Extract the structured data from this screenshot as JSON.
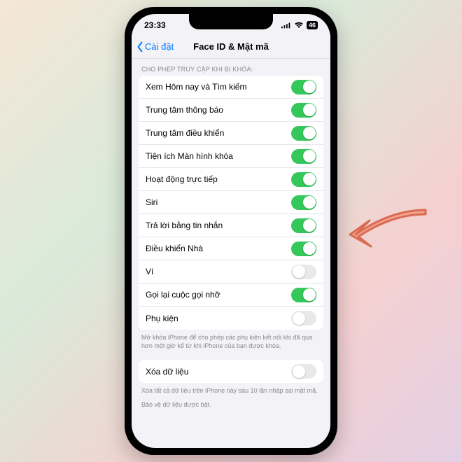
{
  "status": {
    "time": "23:33",
    "battery_text": "46"
  },
  "nav": {
    "back_label": "Cài đặt",
    "title": "Face ID & Mật mã"
  },
  "section1": {
    "header": "CHO PHÉP TRUY CẬP KHI BỊ KHÓA:",
    "rows": [
      {
        "label": "Xem Hôm nay và Tìm kiếm",
        "on": true
      },
      {
        "label": "Trung tâm thông báo",
        "on": true
      },
      {
        "label": "Trung tâm điều khiển",
        "on": true
      },
      {
        "label": "Tiện ích Màn hình khóa",
        "on": true
      },
      {
        "label": "Hoạt động trực tiếp",
        "on": true
      },
      {
        "label": "Siri",
        "on": true
      },
      {
        "label": "Trả lời bằng tin nhắn",
        "on": true
      },
      {
        "label": "Điều khiển Nhà",
        "on": true
      },
      {
        "label": "Ví",
        "on": false
      },
      {
        "label": "Gọi lại cuộc gọi nhỡ",
        "on": true
      },
      {
        "label": "Phụ kiện",
        "on": false
      }
    ],
    "footer": "Mở khóa iPhone để cho phép các phụ kiện kết nối khi đã qua hơn một giờ kể từ khi iPhone của bạn được khóa."
  },
  "section2": {
    "rows": [
      {
        "label": "Xóa dữ liệu",
        "on": false
      }
    ],
    "footer": "Xóa tất cả dữ liệu trên iPhone này sau 10 lần nhập sai mật mã.",
    "footer2": "Bảo vệ dữ liệu được bật."
  },
  "annotation": {
    "arrow_color": "#e8856f"
  }
}
